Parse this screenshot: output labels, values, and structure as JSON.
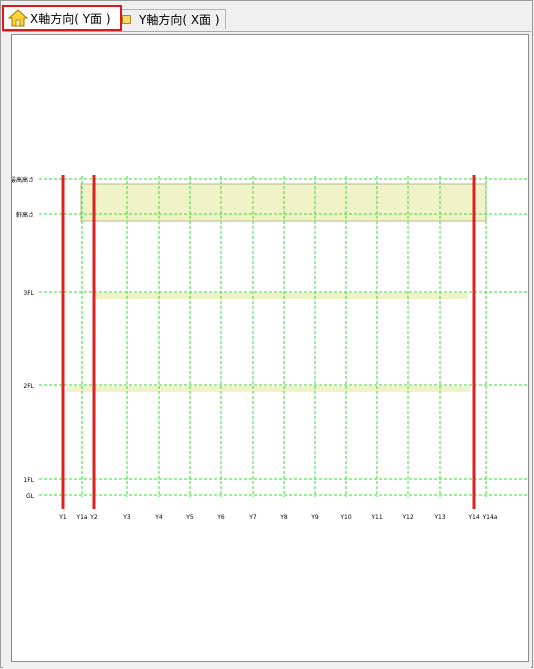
{
  "tabs": [
    {
      "label": "X軸方向( Y面 )",
      "active": true,
      "icon": "home-icon"
    },
    {
      "label": "Y軸方向( X面 )",
      "active": false,
      "icon": "square-icon"
    }
  ],
  "levels": [
    {
      "label": "最高高さ"
    },
    {
      "label": "軒高さ"
    },
    {
      "label": "3FL"
    },
    {
      "label": "2FL"
    },
    {
      "label": "1FL"
    },
    {
      "label": "GL"
    }
  ],
  "gridlines": [
    "Y1",
    "Y1a",
    "Y2",
    "Y3",
    "Y4",
    "Y5",
    "Y6",
    "Y7",
    "Y8",
    "Y9",
    "Y10",
    "Y11",
    "Y12",
    "Y13",
    "Y14",
    "Y14a"
  ],
  "highlighted_gridlines": [
    "Y1",
    "Y2",
    "Y14"
  ],
  "colors": {
    "gridline": "#33e033",
    "highlight": "#e02020",
    "band_fill": "#f0f2c8",
    "band_stroke": "#b8bb88",
    "active_tab_border": "#e0161b"
  }
}
